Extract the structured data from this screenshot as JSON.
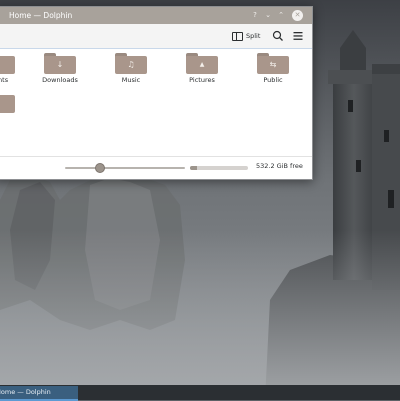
{
  "window": {
    "title": "Home — Dolphin",
    "buttons": {
      "help_glyph": "?",
      "minimize_glyph": "⌄",
      "maximize_glyph": "⌃",
      "close_glyph": "✕"
    }
  },
  "toolbar": {
    "split_label": "Split",
    "search_icon": "search-icon",
    "menu_icon": "hamburger-menu-icon"
  },
  "folders": [
    {
      "name": "folder-documents",
      "label": "nents",
      "icon": "folder-icon",
      "glyph": ""
    },
    {
      "name": "folder-downloads",
      "label": "Downloads",
      "icon": "download-icon",
      "glyph": "↓"
    },
    {
      "name": "folder-music",
      "label": "Music",
      "icon": "music-note-icon",
      "glyph": "♫"
    },
    {
      "name": "folder-pictures",
      "label": "Pictures",
      "icon": "image-icon",
      "glyph": "▲"
    },
    {
      "name": "folder-public",
      "label": "Public",
      "icon": "share-icon",
      "glyph": "⇆"
    },
    {
      "name": "folder-other",
      "label": "",
      "icon": "folder-icon",
      "glyph": ""
    }
  ],
  "statusbar": {
    "zoom_level": 0.28,
    "free_space_label": "532.2 GiB free",
    "used_fraction": 0.12
  },
  "taskbar": {
    "task_label": "Home — Dolphin"
  },
  "colors": {
    "titlebar": "#a8a29b",
    "folder": "#a9968b",
    "panel": "#2b2f33",
    "task_active": "#3a5f7f"
  }
}
